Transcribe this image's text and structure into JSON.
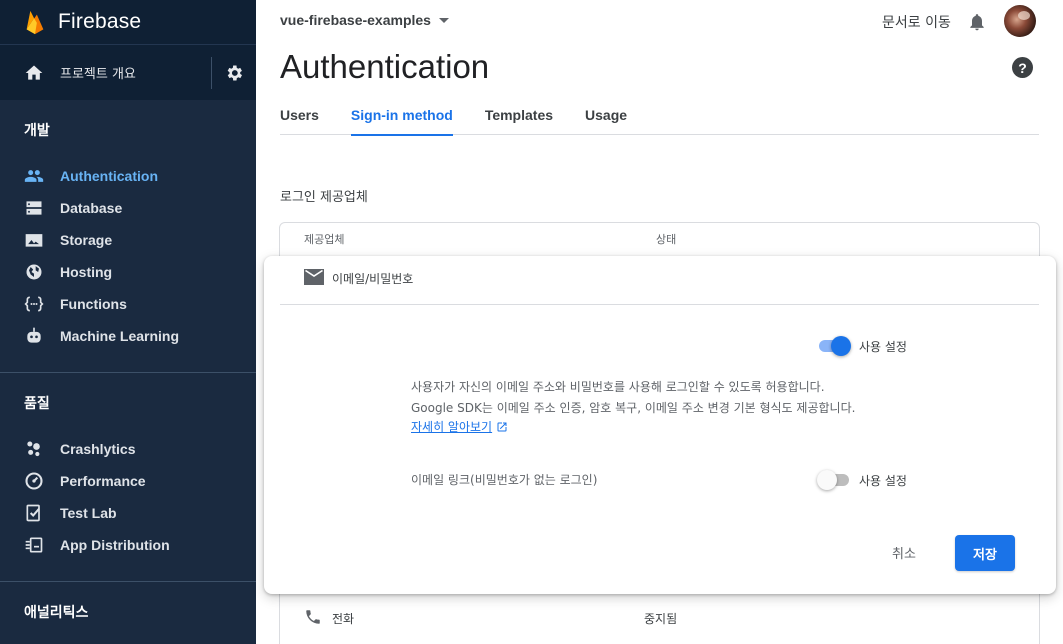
{
  "sidebar": {
    "brand": "Firebase",
    "overview_label": "프로젝트 개요",
    "sections": [
      {
        "title": "개발",
        "items": [
          {
            "label": "Authentication",
            "icon": "people-icon",
            "active": true
          },
          {
            "label": "Database",
            "icon": "database-icon"
          },
          {
            "label": "Storage",
            "icon": "storage-icon"
          },
          {
            "label": "Hosting",
            "icon": "hosting-icon"
          },
          {
            "label": "Functions",
            "icon": "functions-icon"
          },
          {
            "label": "Machine Learning",
            "icon": "robot-icon"
          }
        ]
      },
      {
        "title": "품질",
        "items": [
          {
            "label": "Crashlytics",
            "icon": "crashlytics-icon"
          },
          {
            "label": "Performance",
            "icon": "performance-icon"
          },
          {
            "label": "Test Lab",
            "icon": "testlab-icon"
          },
          {
            "label": "App Distribution",
            "icon": "app-distribution-icon"
          }
        ]
      },
      {
        "title": "애널리틱스",
        "items": []
      }
    ]
  },
  "header": {
    "project": "vue-firebase-examples",
    "docs_link": "문서로 이동",
    "title": "Authentication",
    "help": "?"
  },
  "tabs": [
    {
      "label": "Users"
    },
    {
      "label": "Sign-in method",
      "active": true
    },
    {
      "label": "Templates"
    },
    {
      "label": "Usage"
    }
  ],
  "providers": {
    "section_title": "로그인 제공업체",
    "col_provider": "제공업체",
    "col_status": "상태",
    "phone": {
      "name": "전화",
      "status": "중지됨"
    }
  },
  "email_panel": {
    "provider_name": "이메일/비밀번호",
    "enable_label": "사용 설정",
    "enabled": true,
    "description_line1": "사용자가 자신의 이메일 주소와 비밀번호를 사용해 로그인할 수 있도록 허용합니다.",
    "description_line2": "Google SDK는 이메일 주소 인증, 암호 복구, 이메일 주소 변경 기본 형식도 제공합니다.",
    "learn_more": "자세히 알아보기",
    "email_link_label": "이메일 링크(비밀번호가 없는 로그인)",
    "email_link_enable_label": "사용 설정",
    "email_link_enabled": false,
    "cancel_label": "취소",
    "save_label": "저장"
  },
  "colors": {
    "sidebar_bg": "#1a2a40",
    "accent": "#1a73e8",
    "active_nav": "#68b3f4"
  }
}
